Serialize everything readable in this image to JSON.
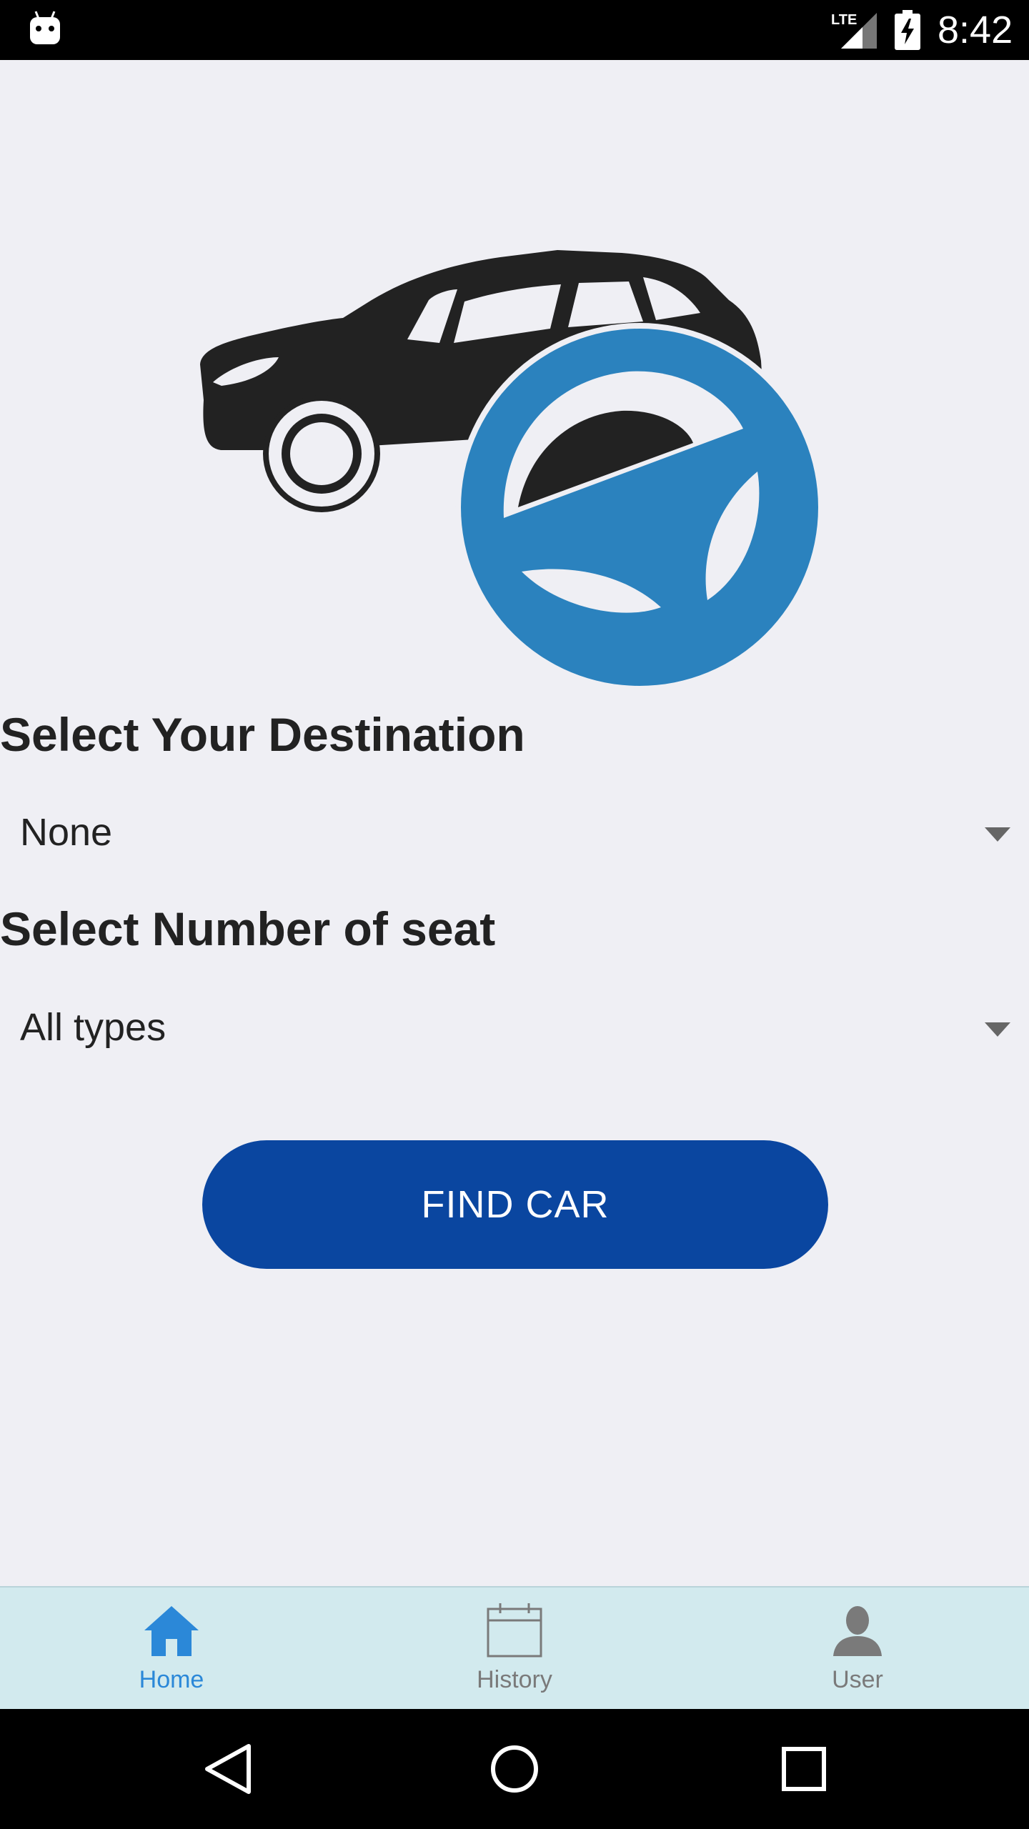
{
  "status_bar": {
    "time": "8:42",
    "network": "LTE",
    "icons": [
      "android-icon",
      "lte-signal-icon",
      "battery-charging-icon"
    ]
  },
  "hero": {
    "icon": "car-steering-wheel-logo"
  },
  "destination": {
    "label": "Select Your Destination",
    "selected": "None"
  },
  "seats": {
    "label": "Select Number of seat",
    "selected": "All types"
  },
  "find_car_button": {
    "label": "FIND CAR"
  },
  "tabs": [
    {
      "label": "Home",
      "icon": "home-icon",
      "active": true
    },
    {
      "label": "History",
      "icon": "calendar-icon",
      "active": false
    },
    {
      "label": "User",
      "icon": "user-icon",
      "active": false
    }
  ],
  "nav_bar": {
    "icons": [
      "back-icon",
      "home-circle-icon",
      "recents-icon"
    ]
  },
  "colors": {
    "accent": "#0a46a0",
    "tab_active": "#2b88d8",
    "tab_inactive": "#7a7a7a",
    "tab_bar_bg": "#d2eaee",
    "page_bg": "#efeff4",
    "wheel_blue": "#2b82be"
  }
}
